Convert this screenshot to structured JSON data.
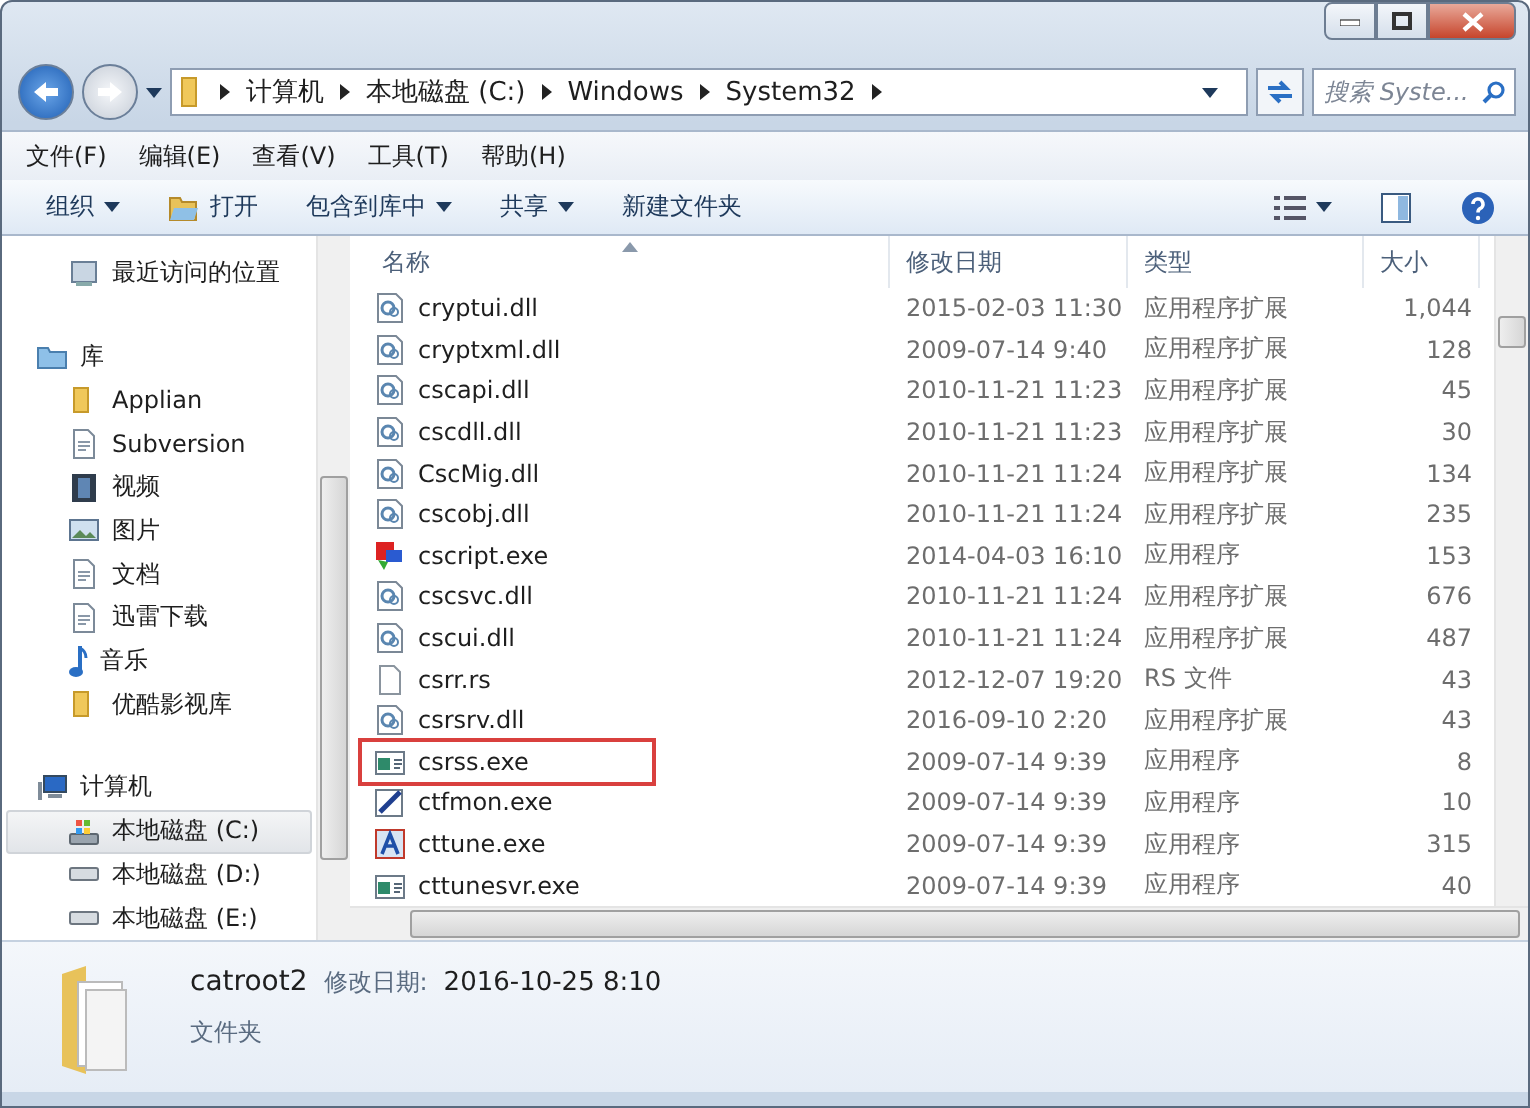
{
  "address_bar": {
    "segments": [
      "计算机",
      "本地磁盘 (C:)",
      "Windows",
      "System32"
    ]
  },
  "search": {
    "placeholder": "搜索 Syste..."
  },
  "menu": [
    "文件(F)",
    "编辑(E)",
    "查看(V)",
    "工具(T)",
    "帮助(H)"
  ],
  "toolbar": [
    {
      "label": "组织",
      "kind": "dropdown"
    },
    {
      "label": "打开",
      "kind": "open"
    },
    {
      "label": "包含到库中",
      "kind": "dropdown"
    },
    {
      "label": "共享",
      "kind": "dropdown"
    },
    {
      "label": "新建文件夹",
      "kind": "plain"
    }
  ],
  "sidebar": {
    "groups": [
      {
        "items": [
          {
            "label": "最近访问的位置",
            "kind": "recent",
            "selected": false
          }
        ]
      },
      {
        "label": "库",
        "kind": "library",
        "selected": false,
        "children": [
          {
            "label": "Applian",
            "kind": "folder",
            "selected": false
          },
          {
            "label": "Subversion",
            "kind": "doc",
            "selected": false
          },
          {
            "label": "视频",
            "kind": "video",
            "selected": false
          },
          {
            "label": "图片",
            "kind": "image",
            "selected": false
          },
          {
            "label": "文档",
            "kind": "doc",
            "selected": false
          },
          {
            "label": "迅雷下载",
            "kind": "doc",
            "selected": false
          },
          {
            "label": "音乐",
            "kind": "music",
            "selected": false
          },
          {
            "label": "优酷影视库",
            "kind": "folder",
            "selected": false
          }
        ]
      },
      {
        "label": "计算机",
        "kind": "computer",
        "selected": false,
        "children": [
          {
            "label": "本地磁盘 (C:)",
            "kind": "sysdrive",
            "selected": true
          },
          {
            "label": "本地磁盘 (D:)",
            "kind": "drive",
            "selected": false
          },
          {
            "label": "本地磁盘 (E:)",
            "kind": "drive",
            "selected": false
          }
        ]
      }
    ]
  },
  "table": {
    "columns": [
      "名称",
      "修改日期",
      "类型",
      "大小"
    ],
    "rows": [
      {
        "name": "cryptui.dll",
        "date": "2015-02-03 11:30",
        "type": "应用程序扩展",
        "size": "1,044",
        "kind": "dll",
        "highlighted": false
      },
      {
        "name": "cryptxml.dll",
        "date": "2009-07-14 9:40",
        "type": "应用程序扩展",
        "size": "128",
        "kind": "dll",
        "highlighted": false
      },
      {
        "name": "cscapi.dll",
        "date": "2010-11-21 11:23",
        "type": "应用程序扩展",
        "size": "45",
        "kind": "dll",
        "highlighted": false
      },
      {
        "name": "cscdll.dll",
        "date": "2010-11-21 11:23",
        "type": "应用程序扩展",
        "size": "30",
        "kind": "dll",
        "highlighted": false
      },
      {
        "name": "CscMig.dll",
        "date": "2010-11-21 11:24",
        "type": "应用程序扩展",
        "size": "134",
        "kind": "dll",
        "highlighted": false
      },
      {
        "name": "cscobj.dll",
        "date": "2010-11-21 11:24",
        "type": "应用程序扩展",
        "size": "235",
        "kind": "dll",
        "highlighted": false
      },
      {
        "name": "cscript.exe",
        "date": "2014-04-03 16:10",
        "type": "应用程序",
        "size": "153",
        "kind": "script",
        "highlighted": false
      },
      {
        "name": "cscsvc.dll",
        "date": "2010-11-21 11:24",
        "type": "应用程序扩展",
        "size": "676",
        "kind": "dll",
        "highlighted": false
      },
      {
        "name": "cscui.dll",
        "date": "2010-11-21 11:24",
        "type": "应用程序扩展",
        "size": "487",
        "kind": "dll",
        "highlighted": false
      },
      {
        "name": "csrr.rs",
        "date": "2012-12-07 19:20",
        "type": "RS 文件",
        "size": "43",
        "kind": "blank",
        "highlighted": false
      },
      {
        "name": "csrsrv.dll",
        "date": "2016-09-10 2:20",
        "type": "应用程序扩展",
        "size": "43",
        "kind": "dll",
        "highlighted": false
      },
      {
        "name": "csrss.exe",
        "date": "2009-07-14 9:39",
        "type": "应用程序",
        "size": "8",
        "kind": "app",
        "highlighted": true
      },
      {
        "name": "ctfmon.exe",
        "date": "2009-07-14 9:39",
        "type": "应用程序",
        "size": "10",
        "kind": "pen",
        "highlighted": false
      },
      {
        "name": "cttune.exe",
        "date": "2009-07-14 9:39",
        "type": "应用程序",
        "size": "315",
        "kind": "font",
        "highlighted": false
      },
      {
        "name": "cttunesvr.exe",
        "date": "2009-07-14 9:39",
        "type": "应用程序",
        "size": "40",
        "kind": "app",
        "highlighted": false
      }
    ]
  },
  "details": {
    "name": "catroot2",
    "date_label": "修改日期:",
    "date": "2016-10-25 8:10",
    "type": "文件夹"
  }
}
